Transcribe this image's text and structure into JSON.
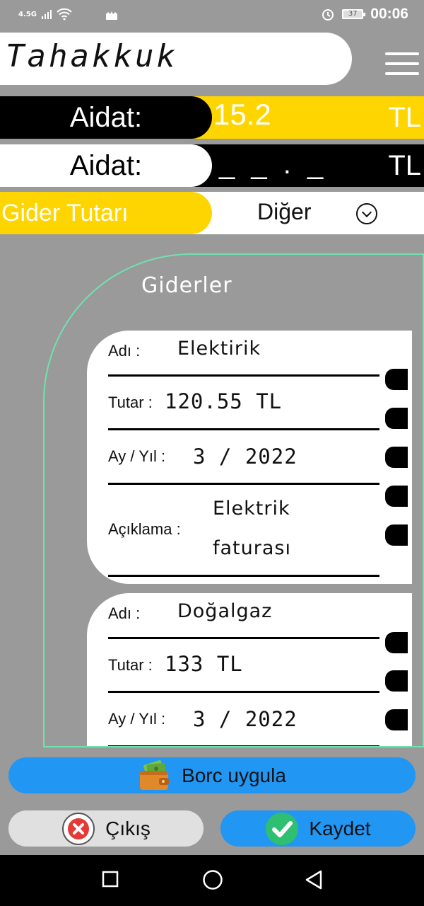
{
  "status": {
    "network": "4.5G",
    "battery": "37",
    "time": "00:06"
  },
  "header": {
    "title": "Tahakkuk"
  },
  "rows": {
    "due1": {
      "label": "Aidat:",
      "value": "15.2",
      "unit": "TL"
    },
    "due2": {
      "label": "Aidat:",
      "value": "_ _ . _",
      "unit": "TL"
    },
    "expense_amount": {
      "label": "Gider Tutarı",
      "selected": "Diğer"
    }
  },
  "expenses": {
    "title": "Giderler",
    "items": [
      {
        "name_label": "Adı :",
        "name": "Elektirik",
        "amount_label": "Tutar :",
        "amount": "120.55 TL",
        "period_label": "Ay / Yıl :",
        "period": "3 / 2022",
        "desc_label": "Açıklama :",
        "desc_line1": "Elektrik",
        "desc_line2": "faturası"
      },
      {
        "name_label": "Adı :",
        "name": "Doğalgaz",
        "amount_label": "Tutar :",
        "amount": "133 TL",
        "period_label": "Ay / Yıl :",
        "period": "3 / 2022"
      }
    ]
  },
  "buttons": {
    "apply_debt": "Borc uygula",
    "exit": "Çıkış",
    "save": "Kaydet"
  },
  "colors": {
    "yellow": "#ffd500",
    "blue": "#2196f3",
    "panel_border": "#6fe2b0",
    "background": "#9a9a9a"
  }
}
